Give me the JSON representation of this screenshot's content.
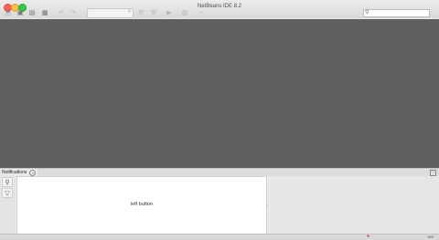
{
  "window": {
    "title": "NetBeans IDE 8.2"
  },
  "toolbar": {
    "new_file_icon": "new-file-icon",
    "new_project_icon": "new-project-icon",
    "open_project_icon": "open-project-icon",
    "save_all_icon": "save-all-icon",
    "undo_icon": "undo-icon",
    "redo_icon": "redo-icon",
    "config_value": "",
    "build_icon": "hammer-icon",
    "clean_build_icon": "clean-build-icon",
    "run_icon": "run-icon",
    "debug_icon": "debug-icon",
    "profile_icon": "profile-icon",
    "search_placeholder": ""
  },
  "bottom_panel": {
    "tab_label": "Notifications",
    "left_pane_text": "left button"
  },
  "status_bar": {
    "text": "INS"
  }
}
